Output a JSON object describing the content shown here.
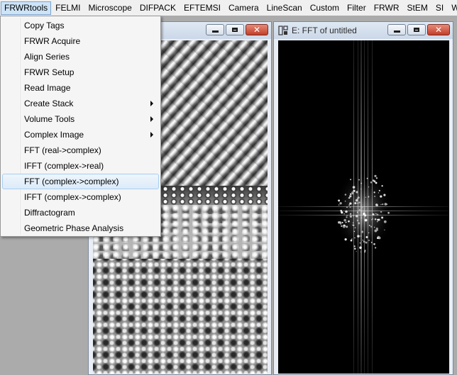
{
  "menubar": {
    "items": [
      "FRWRtools",
      "FELMI",
      "Microscope",
      "DIFPACK",
      "EFTEMSI",
      "Camera",
      "LineScan",
      "Custom",
      "Filter",
      "FRWR",
      "StEM",
      "SI",
      "W"
    ]
  },
  "dropdown": {
    "items": [
      {
        "label": "Copy Tags",
        "submenu": false
      },
      {
        "label": "FRWR Acquire",
        "submenu": false
      },
      {
        "label": "Align Series",
        "submenu": false
      },
      {
        "label": "FRWR Setup",
        "submenu": false
      },
      {
        "label": "Read Image",
        "submenu": false
      },
      {
        "label": "Create Stack",
        "submenu": true
      },
      {
        "label": "Volume Tools",
        "submenu": true
      },
      {
        "label": "Complex Image",
        "submenu": true
      },
      {
        "label": "FFT (real->complex)",
        "submenu": false
      },
      {
        "label": "IFFT (complex->real)",
        "submenu": false
      },
      {
        "label": "FFT (complex->complex)",
        "submenu": false,
        "highlighted": true
      },
      {
        "label": "IFFT (complex->complex)",
        "submenu": false
      },
      {
        "label": "Diffractogram",
        "submenu": false
      },
      {
        "label": "Geometric Phase Analysis",
        "submenu": false
      }
    ]
  },
  "windows": {
    "left": {
      "title": ""
    },
    "right": {
      "title": "E: FFT of untitled"
    }
  },
  "colors": {
    "menubar_bg": "#f0f0f0",
    "workspace_bg": "#ababab",
    "close_button": "#c2402a",
    "highlight": "#dcebf9"
  }
}
